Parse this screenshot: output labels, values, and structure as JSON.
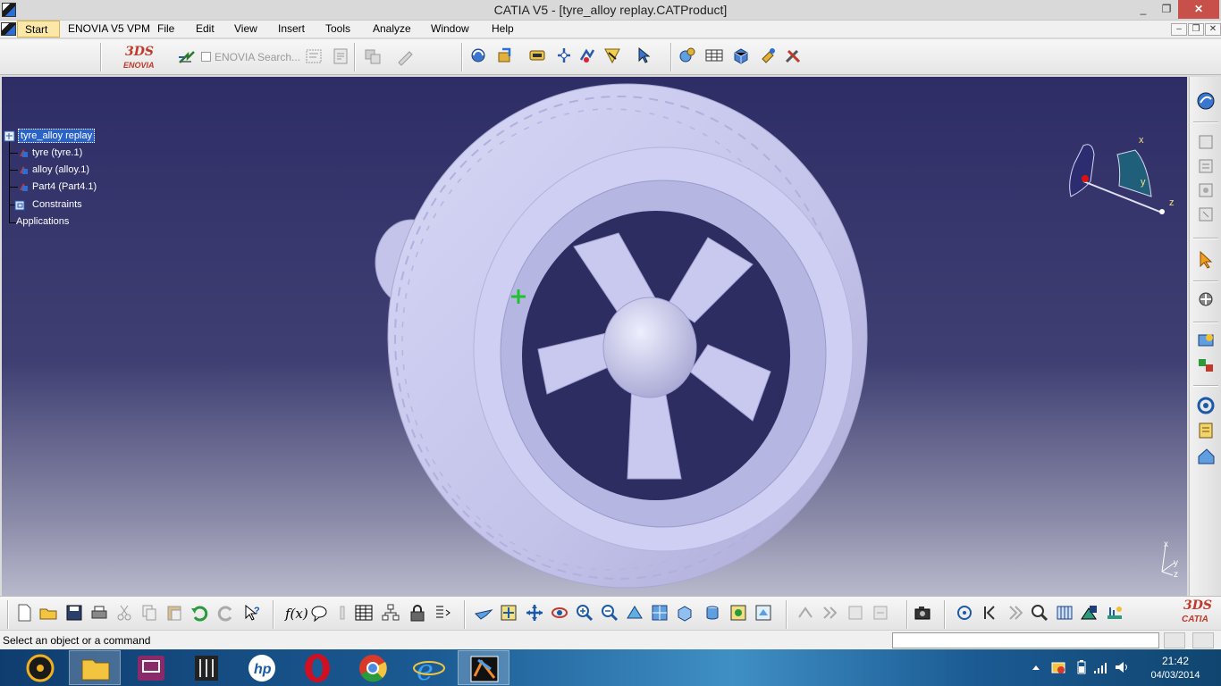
{
  "window": {
    "title": "CATIA V5 - [tyre_alloy replay.CATProduct]",
    "minimize": "_",
    "restore": "❐",
    "close": "✕"
  },
  "menubar": {
    "items": [
      "Start",
      "ENOVIA V5 VPM",
      "File",
      "Edit",
      "View",
      "Insert",
      "Tools",
      "Analyze",
      "Window",
      "Help"
    ],
    "mdi_minimize": "–",
    "mdi_restore": "❐",
    "mdi_close": "✕"
  },
  "toolbar_top": {
    "enovia_logo_ds": "3DS",
    "enovia_logo_text": "ENOVIA",
    "enovia_search_label": "ENOVIA Search...",
    "icons": [
      "enovia-connect-icon",
      "options-icon",
      "document-icon",
      "disabled-swap-icon",
      "disabled-edit-icon",
      "rotate-view-icon",
      "refresh-icon",
      "workbench-icon",
      "manipulate-icon",
      "snap-icon",
      "clash-icon",
      "select-icon",
      "catalog-icon",
      "bom-icon",
      "component-icon",
      "paint-icon",
      "tools-icon"
    ]
  },
  "tree": {
    "items": [
      {
        "label": "tyre_alloy replay",
        "kind": "product",
        "selected": true
      },
      {
        "label": "tyre (tyre.1)",
        "kind": "part"
      },
      {
        "label": "alloy (alloy.1)",
        "kind": "part"
      },
      {
        "label": "Part4 (Part4.1)",
        "kind": "part"
      },
      {
        "label": "Constraints",
        "kind": "constraints"
      },
      {
        "label": "Applications",
        "kind": "applications"
      }
    ]
  },
  "compass": {
    "x": "x",
    "y": "y",
    "z": "z"
  },
  "axis_triad": {
    "x": "x",
    "y": "y",
    "z": "z"
  },
  "colors": {
    "viewport_top": "#2e2d66",
    "viewport_bottom": "#b9b9cc",
    "model_fill": "#c9c9ef",
    "selection_blue": "#2b62c7",
    "close_red": "#c7514a"
  },
  "bottom_toolbar": {
    "catia_logo_ds": "3DS",
    "catia_logo_text": "CATIA",
    "formula_label": "f(x)"
  },
  "status": {
    "message": "Select an object or a command",
    "command_input": ""
  },
  "taskbar": {
    "apps": [
      "media-player-icon",
      "file-explorer-icon",
      "remote-desktop-icon",
      "mixer-icon",
      "hp-icon",
      "opera-icon",
      "chrome-icon",
      "internet-explorer-icon",
      "catia-taskbar-icon"
    ],
    "time": "21:42",
    "date": "04/03/2014"
  }
}
